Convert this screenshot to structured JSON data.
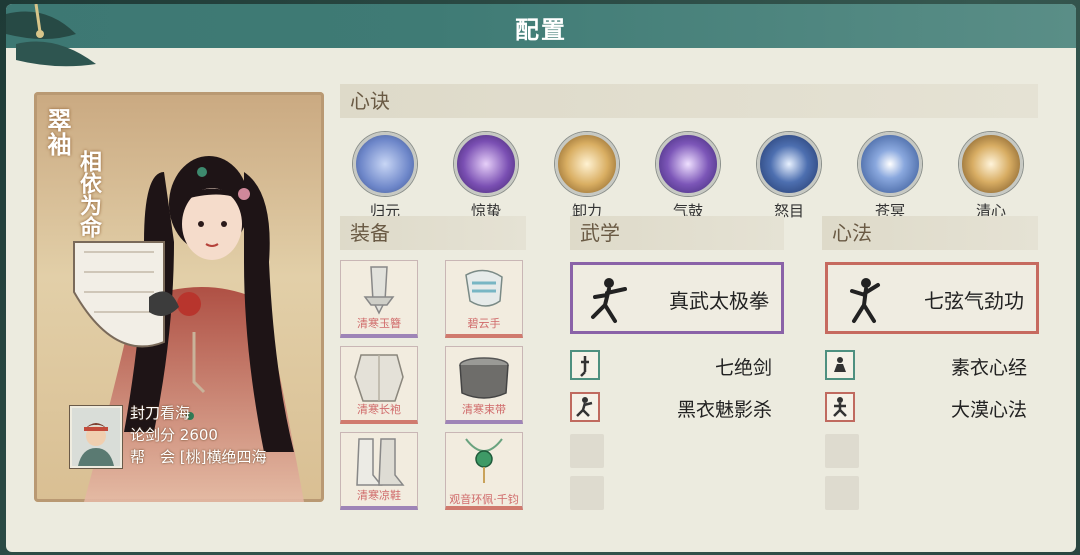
{
  "window": {
    "title": "配置"
  },
  "character": {
    "title": "翠袖",
    "subtitle": "相依为命",
    "player_name": "封刀看海",
    "score_label": "论剑分",
    "score_value": "2600",
    "guild_label": "帮　会",
    "guild_name": "[桃]横绝四海"
  },
  "sections": {
    "xinjue": "心诀",
    "equipment": "装备",
    "martial": "武学",
    "xinfa": "心法"
  },
  "skills": [
    {
      "name": "归元",
      "icon": "meditation-icon",
      "color": "#6d86c9"
    },
    {
      "name": "惊蛰",
      "icon": "lightning-icon",
      "color": "#7a4fb3"
    },
    {
      "name": "卸力",
      "icon": "swirl-icon",
      "color": "#c89a4e"
    },
    {
      "name": "气鼓",
      "icon": "vortex-icon",
      "color": "#7c56b8"
    },
    {
      "name": "怒目",
      "icon": "eye-icon",
      "color": "#4d6fb0"
    },
    {
      "name": "苍冥",
      "icon": "taiji-icon",
      "color": "#4a70b0"
    },
    {
      "name": "清心",
      "icon": "lotus-icon",
      "color": "#c99a4e"
    }
  ],
  "equipment": [
    {
      "name": "清寒玉簪",
      "icon": "hairpin-icon",
      "rarity": "purple"
    },
    {
      "name": "碧云手",
      "icon": "gauntlet-icon",
      "rarity": "red"
    },
    {
      "name": "清寒长袍",
      "icon": "robe-icon",
      "rarity": "red"
    },
    {
      "name": "清寒束带",
      "icon": "belt-icon",
      "rarity": "purple"
    },
    {
      "name": "清寒凉鞋",
      "icon": "boots-icon",
      "rarity": "purple"
    },
    {
      "name": "观音环佩·千钧",
      "icon": "pendant-icon",
      "rarity": "red"
    }
  ],
  "martial": {
    "main": "真武太极拳",
    "sub": [
      "七绝剑",
      "黑衣魅影杀"
    ]
  },
  "xinfa": {
    "main": "七弦气劲功",
    "sub": [
      "素衣心经",
      "大漠心法"
    ]
  },
  "colors": {
    "accent": "#3f7b75",
    "purple_frame": "#8a62a8",
    "red_frame": "#c66a5f"
  }
}
